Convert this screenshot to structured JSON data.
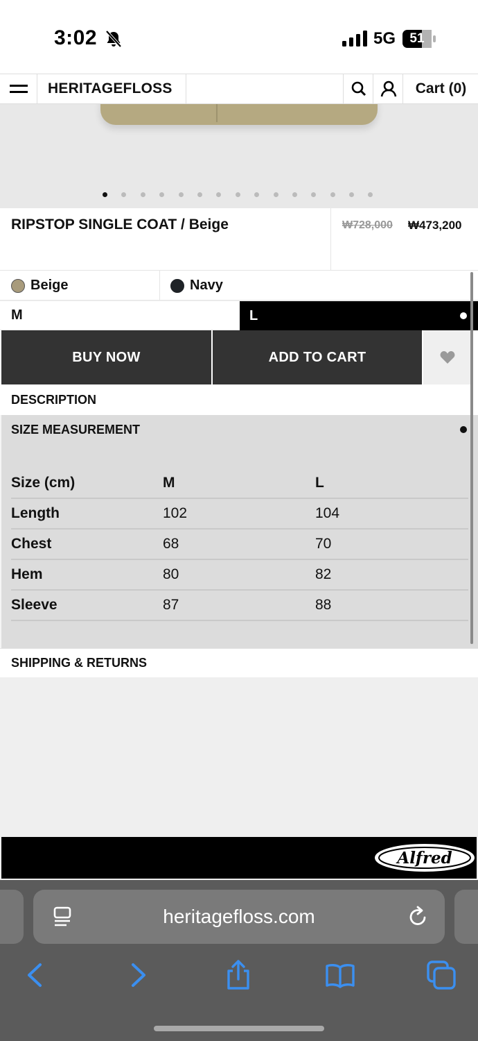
{
  "status_bar": {
    "time": "3:02",
    "network": "5G",
    "battery": "51"
  },
  "header": {
    "brand": "HERITAGEFLOSS",
    "cart_label": "Cart (0)"
  },
  "gallery": {
    "image_count": 15,
    "active_index": 0
  },
  "product": {
    "title": "RIPSTOP SINGLE COAT / Beige",
    "original_price": "₩728,000",
    "sale_price": "₩473,200"
  },
  "colors": [
    {
      "label": "Beige",
      "swatch": "#a89b7c"
    },
    {
      "label": "Navy",
      "swatch": "#1f2327"
    }
  ],
  "sizes": {
    "m": "M",
    "l": "L",
    "selected": "L"
  },
  "actions": {
    "buy_now": "BUY NOW",
    "add_to_cart": "ADD TO CART"
  },
  "accordion": {
    "description": "DESCRIPTION",
    "size_measurement": "SIZE MEASUREMENT",
    "shipping_returns": "SHIPPING & RETURNS"
  },
  "size_table": {
    "headers": [
      "Size (cm)",
      "M",
      "L"
    ],
    "rows": [
      [
        "Length",
        "102",
        "104"
      ],
      [
        "Chest",
        "68",
        "70"
      ],
      [
        "Hem",
        "80",
        "82"
      ],
      [
        "Sleeve",
        "87",
        "88"
      ]
    ]
  },
  "footer": {
    "logo_text": "Alfred"
  },
  "browser": {
    "url": "heritagefloss.com"
  },
  "colors_theme": {
    "button_bg": "#333333",
    "selected_bg": "#000000",
    "accordion_open_bg": "#dcdcdc",
    "link_blue": "#3b8ff0"
  }
}
